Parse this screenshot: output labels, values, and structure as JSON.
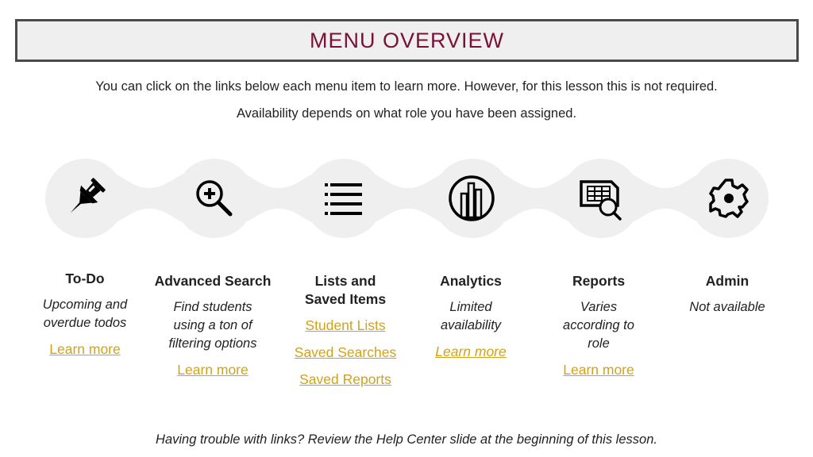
{
  "header": {
    "title": "MENU OVERVIEW"
  },
  "intro": {
    "line1": "You can click on the links below each menu item to learn more. However, for this lesson this is not required.",
    "line2": "Availability depends on what role you have been assigned."
  },
  "colors": {
    "title": "#7a1038",
    "link": "#d1a21a",
    "blob": "#efefef",
    "text": "#222222"
  },
  "menu_items": [
    {
      "icon": "pushpin-icon",
      "title": "To-Do",
      "description": "Upcoming and overdue todos",
      "links": [
        "Learn more"
      ]
    },
    {
      "icon": "zoom-in-search-icon",
      "title": "Advanced Search",
      "description": "Find students using a ton of filtering options",
      "links": [
        "Learn more"
      ]
    },
    {
      "icon": "list-icon",
      "title": "Lists and Saved Items",
      "description": "",
      "links": [
        "Student Lists",
        "Saved Searches",
        "Saved Reports"
      ]
    },
    {
      "icon": "bar-chart-circle-icon",
      "title": "Analytics",
      "description": "Limited availability",
      "links": [
        "Learn more"
      ]
    },
    {
      "icon": "report-search-icon",
      "title": "Reports",
      "description": "Varies according to role",
      "links": [
        "Learn more"
      ]
    },
    {
      "icon": "gear-icon",
      "title": "Admin",
      "description": "Not available",
      "links": []
    }
  ],
  "footer": {
    "note": "Having trouble with links? Review the Help Center slide at the beginning of this lesson."
  }
}
